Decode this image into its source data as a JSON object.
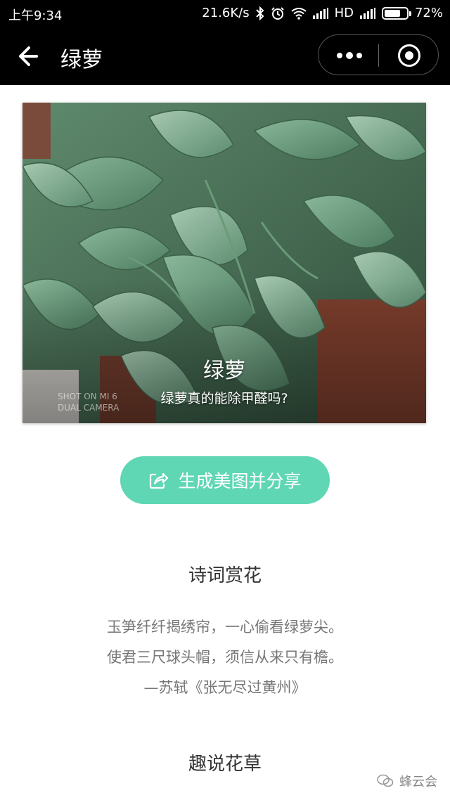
{
  "status_bar": {
    "time": "上午9:34",
    "network_speed": "21.6K/s",
    "network_type": "HD",
    "battery": "72%",
    "battery_level": 0.72,
    "icons": [
      "bluetooth-icon",
      "alarm-icon",
      "wifi-icon",
      "signal-icon",
      "battery-icon"
    ]
  },
  "nav": {
    "back_icon": "arrow-left-icon",
    "title": "绿萝",
    "more_icon": "more-dots-icon",
    "close_icon": "target-close-icon"
  },
  "hero": {
    "title": "绿萝",
    "subtitle": "绿萝真的能除甲醛吗?",
    "watermark_line1": "SHOT ON MI 6",
    "watermark_line2": "DUAL CAMERA"
  },
  "share_button": {
    "icon": "share-icon",
    "label": "生成美图并分享",
    "color": "#5fd6b4"
  },
  "poem_section": {
    "title": "诗词赏花",
    "lines": [
      "玉笋纤纤揭绣帘，一心偷看绿萝尖。",
      "使君三尺球头帽，须信从来只有檐。",
      "—苏轼《张无尽过黄州》"
    ]
  },
  "fun_section": {
    "title": "趣说花草"
  },
  "brand": {
    "icon": "wechat-icon",
    "text": "蜂云会"
  }
}
